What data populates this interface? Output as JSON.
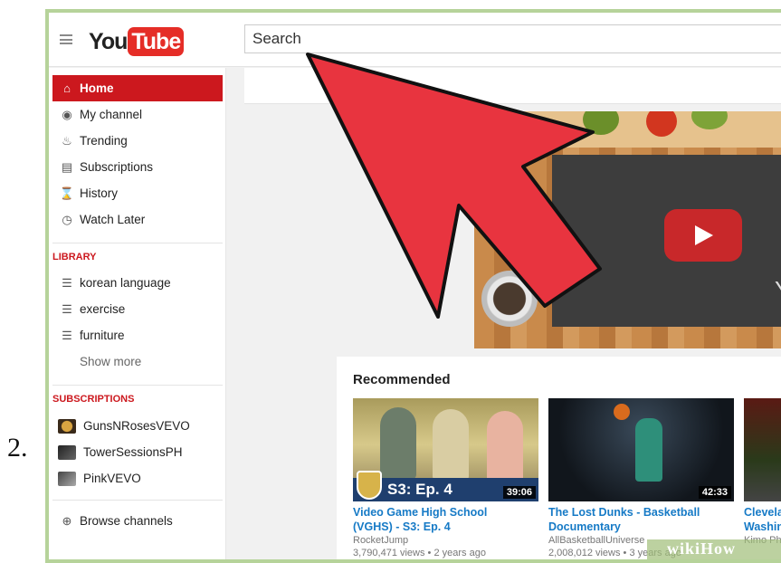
{
  "step_number": "2.",
  "header": {
    "logo_you": "You",
    "logo_tube": "Tube",
    "search_placeholder": "Search"
  },
  "sidebar": {
    "nav": [
      {
        "label": "Home",
        "icon": "home-icon",
        "active": true
      },
      {
        "label": "My channel",
        "icon": "user-icon",
        "active": false
      },
      {
        "label": "Trending",
        "icon": "flame-icon",
        "active": false
      },
      {
        "label": "Subscriptions",
        "icon": "subscriptions-icon",
        "active": false
      },
      {
        "label": "History",
        "icon": "hourglass-icon",
        "active": false
      },
      {
        "label": "Watch Later",
        "icon": "clock-icon",
        "active": false
      }
    ],
    "library_title": "LIBRARY",
    "library": [
      {
        "label": "korean language",
        "icon": "playlist-icon"
      },
      {
        "label": "exercise",
        "icon": "playlist-icon"
      },
      {
        "label": "furniture",
        "icon": "playlist-icon"
      }
    ],
    "show_more": "Show more",
    "subscriptions_title": "SUBSCRIPTIONS",
    "subscriptions": [
      {
        "label": "GunsNRosesVEVO"
      },
      {
        "label": "TowerSessionsPH"
      },
      {
        "label": "PinkVEVO"
      }
    ],
    "browse_channels": "Browse channels"
  },
  "main": {
    "banner_letter": "Yo",
    "recommended_title": "Recommended",
    "videos": [
      {
        "title_line1": "Video Game High School",
        "title_line2": "(VGHS) - S3: Ep. 4",
        "channel": "RocketJump",
        "meta": "3,790,471 views • 2 years ago",
        "duration": "39:06",
        "overlay": "S3: Ep. 4"
      },
      {
        "title_line1": "The Lost Dunks - Basketball",
        "title_line2": "Documentary",
        "channel": "AllBasketballUniverse",
        "meta": "2,008,012 views • 3 years ago",
        "duration": "42:33"
      },
      {
        "title_line1": "Clevela",
        "title_line2": "Washin",
        "channel": "Kimo Ph",
        "meta": ""
      }
    ]
  },
  "watermark": "wikiHow",
  "colors": {
    "youtube_red": "#cc181e",
    "annotation_arrow": "#e8343f",
    "link_blue": "#167ac6",
    "frame_green": "#b6d39a"
  }
}
